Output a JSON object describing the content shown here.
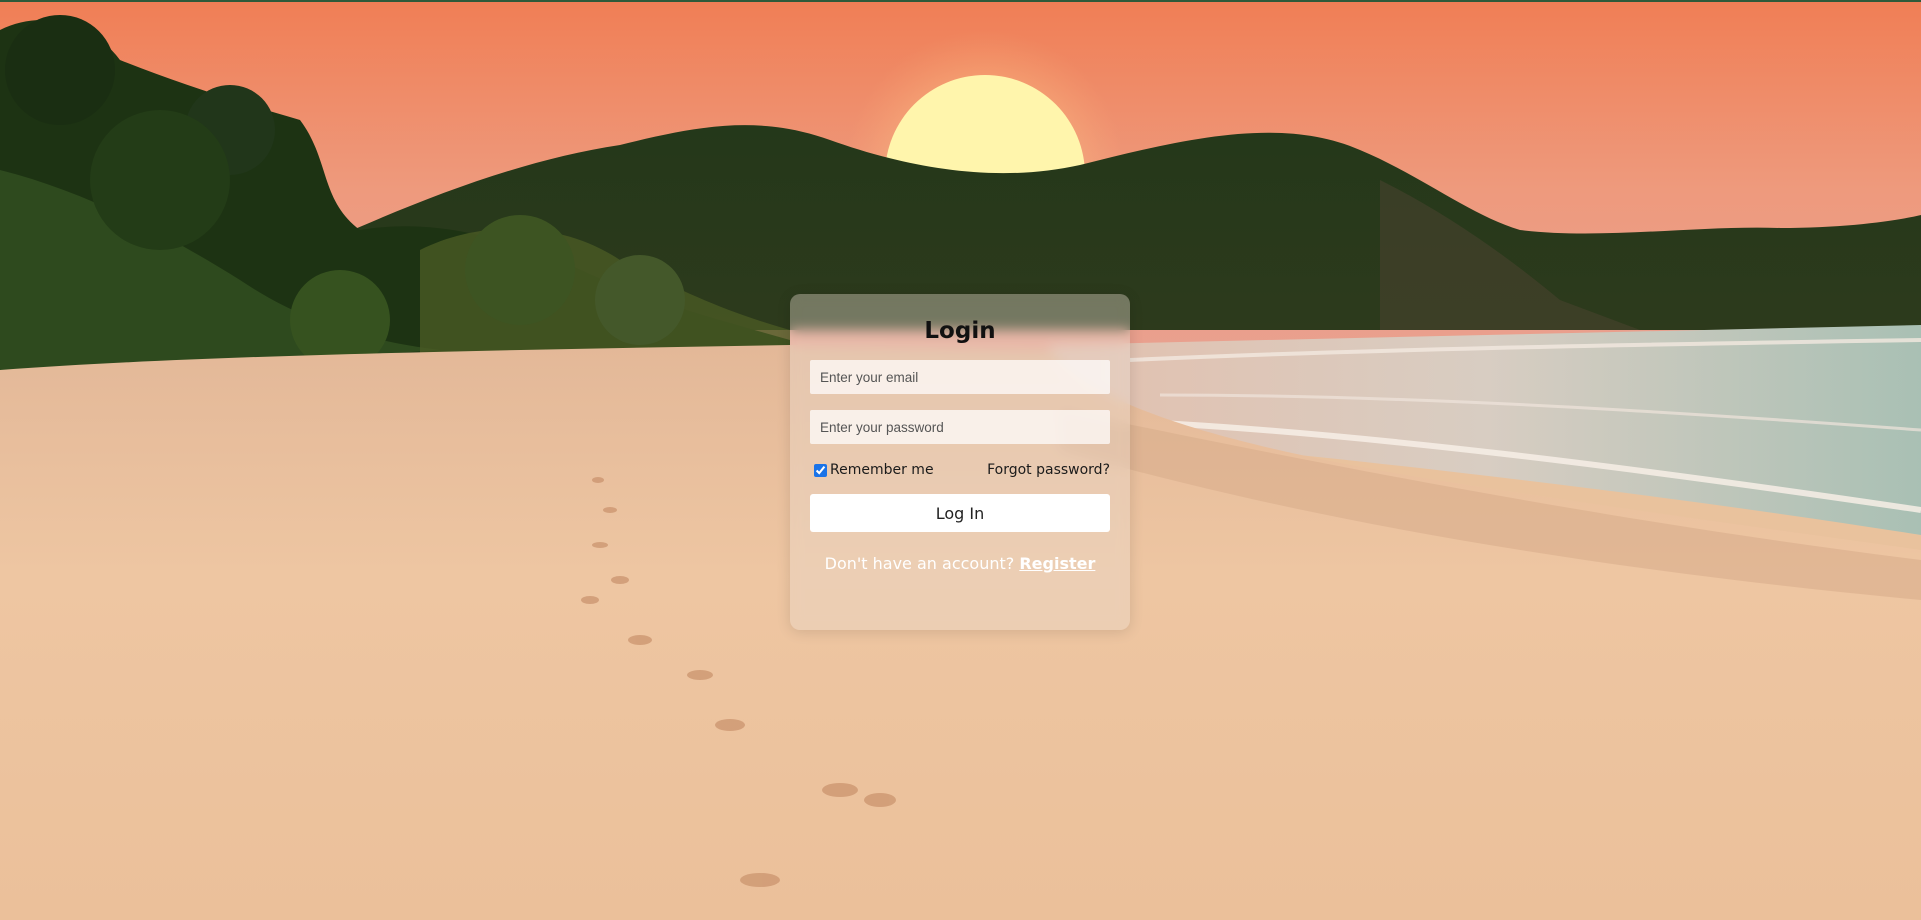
{
  "login": {
    "title": "Login",
    "email_placeholder": "Enter your email",
    "password_placeholder": "Enter your password",
    "remember_label": "Remember me",
    "remember_checked": true,
    "forgot_label": "Forgot password?",
    "submit_label": "Log In",
    "register_prompt": "Don't have an account?",
    "register_label": "Register"
  },
  "colors": {
    "sky_top": "#f2835c",
    "sky_bottom": "#e59a8a",
    "sun": "#fff3a8",
    "hills": "#1f3318",
    "sand": "#e9c29d",
    "sea": "#b7c3b6",
    "button": "#ffffff"
  }
}
